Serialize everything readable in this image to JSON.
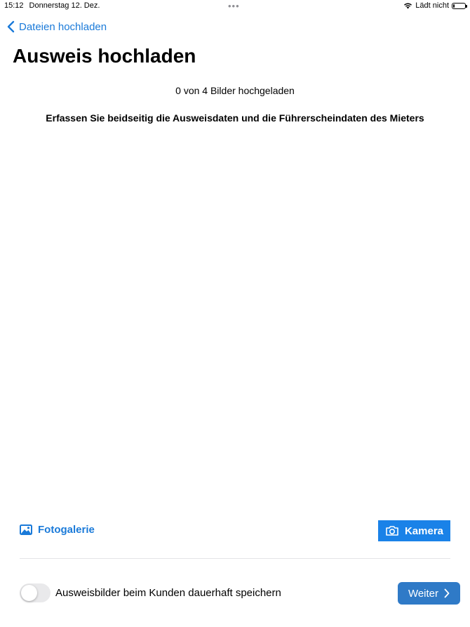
{
  "status_bar": {
    "time": "15:12",
    "date": "Donnerstag 12. Dez.",
    "charging": "Lädt nicht",
    "wifi_icon": "wifi-icon",
    "battery_level": 0.15
  },
  "nav": {
    "back_label": "Dateien hochladen",
    "back_icon": "chevron-left-icon"
  },
  "page": {
    "title": "Ausweis hochladen",
    "upload_count": "0 von 4 Bilder hochgeladen",
    "instruction": "Erfassen Sie beidseitig die Ausweisdaten und die Führerscheindaten des Mieters"
  },
  "actions": {
    "gallery_label": "Fotogalerie",
    "gallery_icon": "photo-icon",
    "camera_label": "Kamera",
    "camera_icon": "camera-icon"
  },
  "footer": {
    "toggle_label": "Ausweisbilder beim Kunden dauerhaft speichern",
    "toggle_on": false,
    "next_label": "Weiter",
    "next_icon": "chevron-right-icon"
  },
  "colors": {
    "accent": "#1a7ad9",
    "camera_bg": "#1a82e8",
    "next_bg": "#2f7ac7"
  }
}
